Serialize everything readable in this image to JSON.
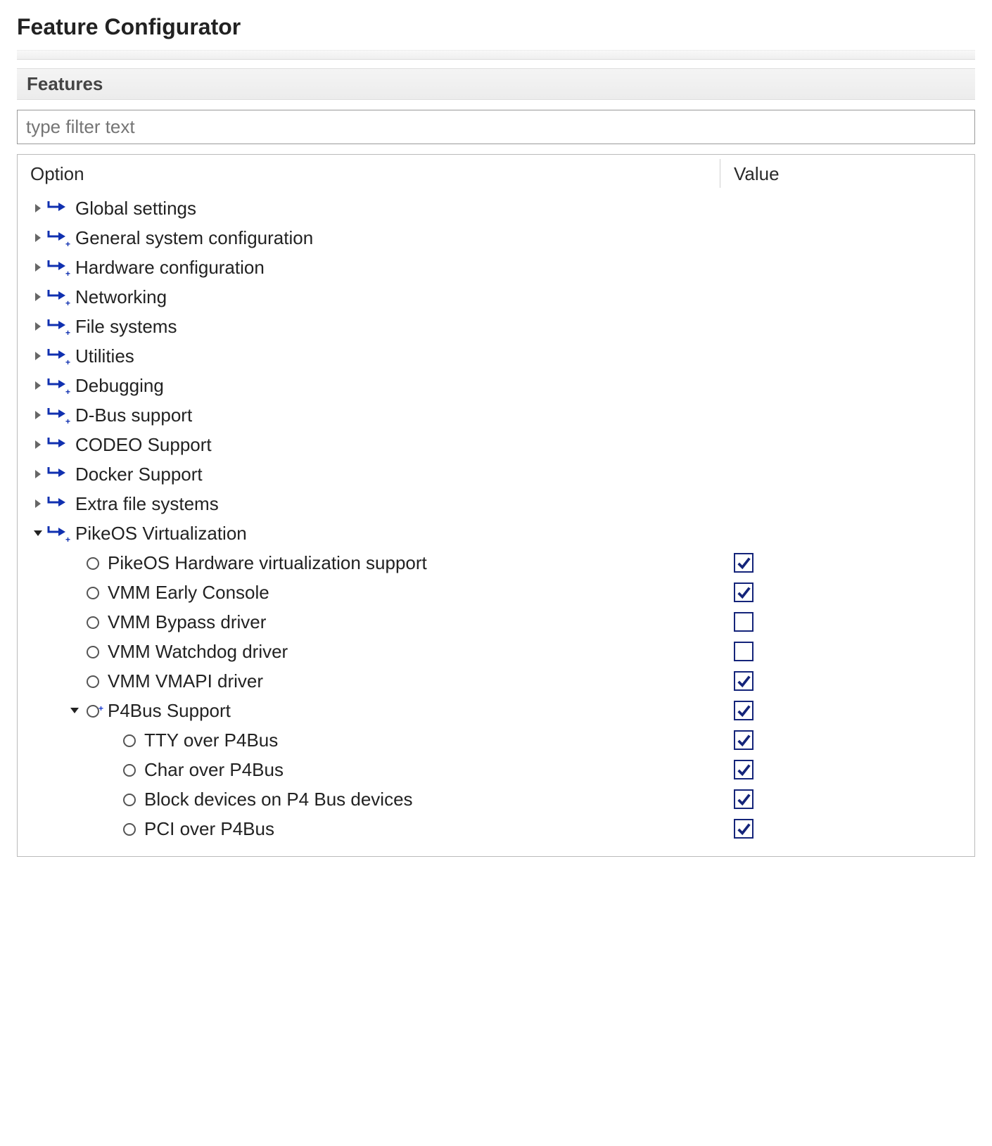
{
  "title": "Feature Configurator",
  "section_label": "Features",
  "filter_placeholder": "type filter text",
  "headers": {
    "option": "Option",
    "value": "Value"
  },
  "tree": [
    {
      "level": 1,
      "expander": "closed",
      "icon": "arrow",
      "label": "Global settings"
    },
    {
      "level": 1,
      "expander": "closed",
      "icon": "arrow-plus",
      "label": "General system configuration"
    },
    {
      "level": 1,
      "expander": "closed",
      "icon": "arrow-plus",
      "label": "Hardware configuration"
    },
    {
      "level": 1,
      "expander": "closed",
      "icon": "arrow-plus",
      "label": "Networking"
    },
    {
      "level": 1,
      "expander": "closed",
      "icon": "arrow-plus",
      "label": "File systems"
    },
    {
      "level": 1,
      "expander": "closed",
      "icon": "arrow-plus",
      "label": "Utilities"
    },
    {
      "level": 1,
      "expander": "closed",
      "icon": "arrow-plus",
      "label": "Debugging"
    },
    {
      "level": 1,
      "expander": "closed",
      "icon": "arrow-plus",
      "label": "D-Bus support"
    },
    {
      "level": 1,
      "expander": "closed",
      "icon": "arrow",
      "label": "CODEO Support"
    },
    {
      "level": 1,
      "expander": "closed",
      "icon": "arrow",
      "label": "Docker Support"
    },
    {
      "level": 1,
      "expander": "closed",
      "icon": "arrow",
      "label": "Extra file systems"
    },
    {
      "level": 1,
      "expander": "open",
      "icon": "arrow-plus",
      "label": "PikeOS Virtualization"
    },
    {
      "level": 2,
      "expander": "none",
      "icon": "leaf",
      "label": "PikeOS Hardware virtualization support",
      "checked": true
    },
    {
      "level": 2,
      "expander": "none",
      "icon": "leaf",
      "label": "VMM Early Console",
      "checked": true
    },
    {
      "level": 2,
      "expander": "none",
      "icon": "leaf",
      "label": "VMM Bypass driver",
      "checked": false
    },
    {
      "level": 2,
      "expander": "none",
      "icon": "leaf",
      "label": "VMM Watchdog driver",
      "checked": false
    },
    {
      "level": 2,
      "expander": "none",
      "icon": "leaf",
      "label": "VMM VMAPI driver",
      "checked": true
    },
    {
      "level": 2,
      "expander": "open",
      "icon": "leaf-plus",
      "label": "P4Bus Support",
      "checked": true
    },
    {
      "level": 3,
      "expander": "none",
      "icon": "leaf",
      "label": "TTY over P4Bus",
      "checked": true
    },
    {
      "level": 3,
      "expander": "none",
      "icon": "leaf",
      "label": "Char over P4Bus",
      "checked": true
    },
    {
      "level": 3,
      "expander": "none",
      "icon": "leaf",
      "label": "Block devices on P4 Bus devices",
      "checked": true
    },
    {
      "level": 3,
      "expander": "none",
      "icon": "leaf",
      "label": "PCI over P4Bus",
      "checked": true
    }
  ]
}
